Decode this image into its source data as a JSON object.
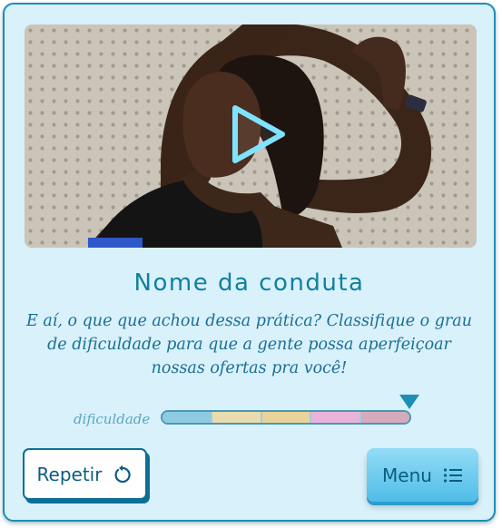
{
  "video": {
    "play_icon": "play-icon"
  },
  "title": "Nome da conduta",
  "description": "E aí, o que que achou dessa prática? Classifique o grau de dificuldade para que a gente possa aperfeiçoar nossas ofertas pra você!",
  "difficulty": {
    "label": "dificuldade",
    "segments": 5,
    "selected_level": 5,
    "segment_colors": [
      "#8ecbe2",
      "#eadcae",
      "#e9d39b",
      "#eab3d9",
      "#d4aabc"
    ],
    "marker_color": "#1c8fb5"
  },
  "buttons": {
    "repeat": {
      "label": "Repetir",
      "icon": "replay-icon"
    },
    "menu": {
      "label": "Menu",
      "icon": "list-icon"
    }
  },
  "colors": {
    "accent": "#11809f",
    "card_background": "#d9f1fb",
    "border": "#1a8fb8"
  }
}
